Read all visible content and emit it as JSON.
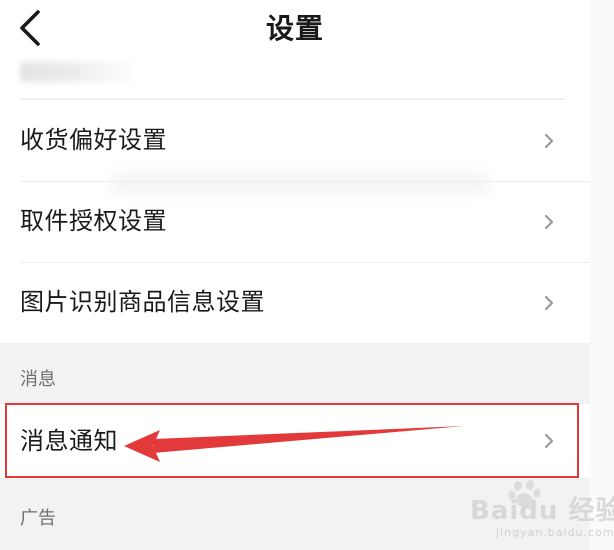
{
  "header": {
    "title": "设置",
    "back_icon": "chevron-left-icon"
  },
  "sections": [
    {
      "title": "",
      "items": [
        {
          "label": "收货偏好设置",
          "icon": "chevron-right-icon"
        },
        {
          "label": "取件授权设置",
          "icon": "chevron-right-icon"
        },
        {
          "label": "图片识别商品信息设置",
          "icon": "chevron-right-icon"
        }
      ]
    },
    {
      "title": "消息",
      "items": [
        {
          "label": "消息通知",
          "icon": "chevron-right-icon"
        }
      ]
    },
    {
      "title": "广告",
      "items": []
    }
  ],
  "annotation": {
    "highlight_color": "#e23a3a"
  },
  "watermark": {
    "brand": "Baidu 经验",
    "url": "jingyan.baidu.com"
  },
  "colors": {
    "background": "#f2f2f2",
    "card": "#ffffff",
    "text": "#1a1a1a",
    "section_title": "#6e6e6e",
    "chevron": "#9a9a9a"
  }
}
